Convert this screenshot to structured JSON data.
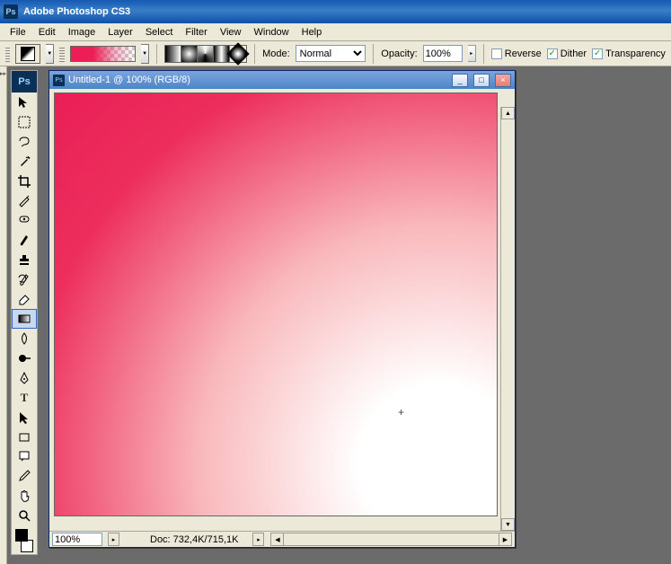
{
  "app": {
    "title": "Adobe Photoshop CS3"
  },
  "menu": [
    "File",
    "Edit",
    "Image",
    "Layer",
    "Select",
    "Filter",
    "View",
    "Window",
    "Help"
  ],
  "options": {
    "mode_label": "Mode:",
    "mode_value": "Normal",
    "opacity_label": "Opacity:",
    "opacity_value": "100%",
    "reverse_label": "Reverse",
    "reverse_checked": false,
    "dither_label": "Dither",
    "dither_checked": true,
    "transparency_label": "Transparency",
    "transparency_checked": true
  },
  "document": {
    "title": "Untitled-1 @ 100% (RGB/8)",
    "zoom": "100%",
    "doc_info": "Doc: 732,4K/715,1K"
  },
  "tools": {
    "ps_label": "Ps"
  }
}
